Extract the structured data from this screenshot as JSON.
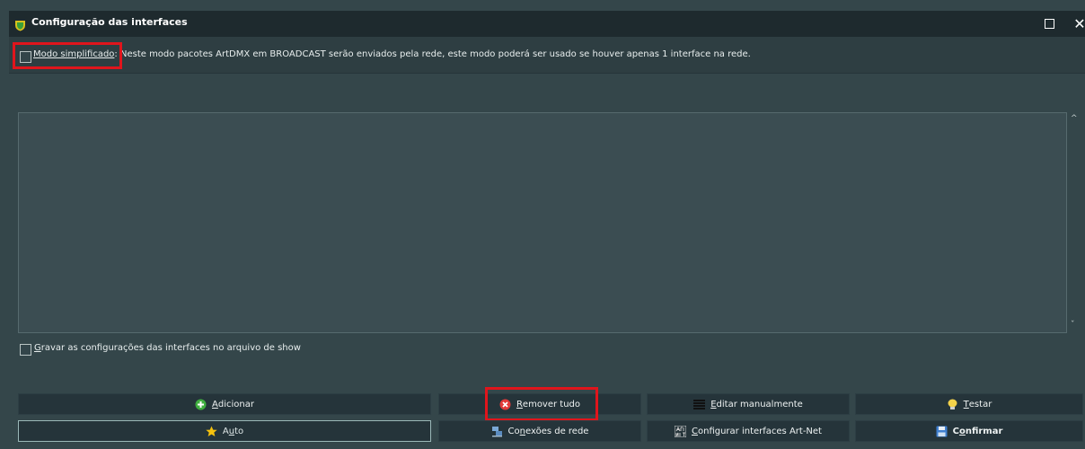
{
  "window": {
    "title": "Configuração das interfaces",
    "maximize_glyph": "□",
    "close_glyph": "✕"
  },
  "options": {
    "simple_mode_label": "Modo simplificado",
    "simple_mode_description": ": Neste modo pacotes ArtDMX em BROADCAST serão enviados pela rede, este modo poderá ser usado se houver apenas 1 interface na rede.",
    "simple_mode_checked": false,
    "save_in_show_label_first": "G",
    "save_in_show_label_rest": "ravar as configurações das interfaces no arquivo de show",
    "save_in_show_checked": false
  },
  "scrollbar": {
    "up_glyph": "^",
    "down_glyph": "ˇ"
  },
  "buttons": {
    "add_u": "A",
    "add_rest": "dicionar",
    "remove_u": "R",
    "remove_rest": "emover tudo",
    "edit_u": "E",
    "edit_rest": "ditar manualmente",
    "test_u": "T",
    "test_rest": "estar",
    "auto_first": "A",
    "auto_u": "u",
    "auto_rest": "to",
    "net_first": "Co",
    "net_u": "n",
    "net_rest": "exões de rede",
    "artnet_u": "C",
    "artnet_rest": "onfigurar interfaces Art-Net",
    "confirm_first": "C",
    "confirm_u": "o",
    "confirm_rest": "nfirmar"
  },
  "colors": {
    "highlight": "#e0151c",
    "background": "#34464a",
    "titlebar": "#1e2a2e"
  },
  "icons": {
    "app": "shield-icon",
    "add": "plus-circle-icon",
    "remove": "x-circle-icon",
    "edit": "list-icon",
    "test": "lightbulb-icon",
    "auto": "star-icon",
    "net": "network-icon",
    "artnet": "artnet-logo-icon",
    "confirm": "floppy-disk-icon"
  }
}
